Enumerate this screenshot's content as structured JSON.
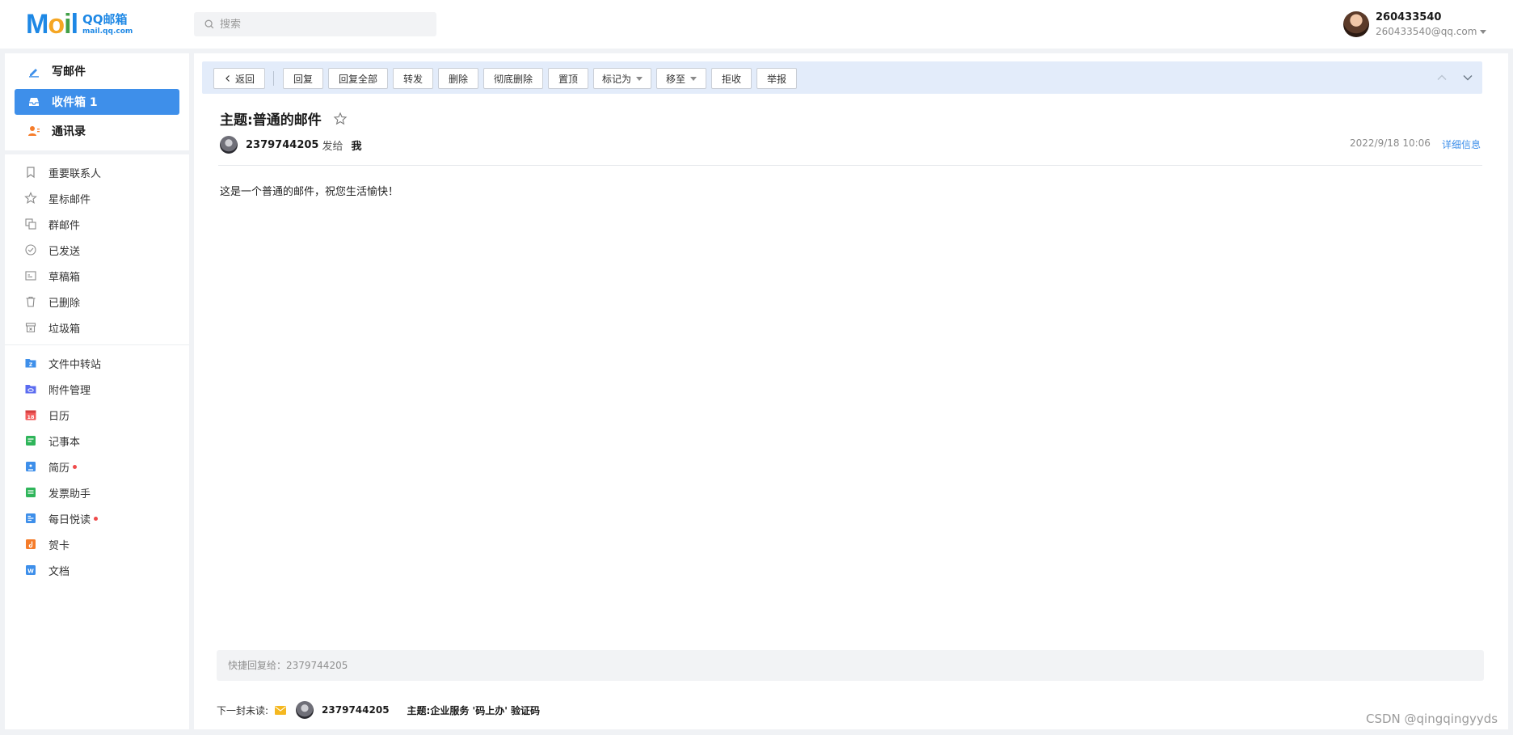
{
  "logo": {
    "word_m": "M",
    "word_o": "o",
    "word_i": "i",
    "word_l": "l",
    "line1": "QQ邮箱",
    "line2": "mail.qq.com"
  },
  "search": {
    "placeholder": "搜索"
  },
  "user": {
    "name": "260433540",
    "email": "260433540@qq.com"
  },
  "sidebar": {
    "main": [
      {
        "label": "写邮件",
        "icon": "pen-icon"
      },
      {
        "label": "收件箱 1",
        "icon": "inbox-icon",
        "active": true
      },
      {
        "label": "通讯录",
        "icon": "contacts-icon"
      }
    ],
    "folders": [
      {
        "label": "重要联系人",
        "icon": "bookmark-icon"
      },
      {
        "label": "星标邮件",
        "icon": "star-icon"
      },
      {
        "label": "群邮件",
        "icon": "group-mail-icon"
      },
      {
        "label": "已发送",
        "icon": "check-circle-icon"
      },
      {
        "label": "草稿箱",
        "icon": "draft-icon"
      },
      {
        "label": "已删除",
        "icon": "trash-icon"
      },
      {
        "label": "垃圾箱",
        "icon": "spam-icon"
      }
    ],
    "apps": [
      {
        "label": "文件中转站",
        "icon": "file-transfer-icon",
        "color": "#3e8fea"
      },
      {
        "label": "附件管理",
        "icon": "attachment-icon",
        "color": "#5b6cf0"
      },
      {
        "label": "日历",
        "icon": "calendar-icon",
        "color": "#f25a5a",
        "badge_text": "18"
      },
      {
        "label": "记事本",
        "icon": "notepad-icon",
        "color": "#2fb55a"
      },
      {
        "label": "简历",
        "icon": "resume-icon",
        "color": "#3e8fea",
        "dot": true
      },
      {
        "label": "发票助手",
        "icon": "invoice-icon",
        "color": "#2fb55a"
      },
      {
        "label": "每日悦读",
        "icon": "reading-icon",
        "color": "#3e8fea",
        "dot": true
      },
      {
        "label": "贺卡",
        "icon": "greeting-card-icon",
        "color": "#f57c2a"
      },
      {
        "label": "文档",
        "icon": "document-icon",
        "color": "#3e8fea",
        "badge_text": "W"
      }
    ]
  },
  "toolbar": {
    "back": "返回",
    "reply": "回复",
    "reply_all": "回复全部",
    "forward": "转发",
    "delete": "删除",
    "delete_permanently": "彻底删除",
    "pin": "置顶",
    "mark_as": "标记为",
    "move_to": "移至",
    "reject": "拒收",
    "report": "举报"
  },
  "mail": {
    "subject": "主题:普通的邮件",
    "sender": "2379744205",
    "sent_to_label": "发给",
    "recipient": "我",
    "date": "2022/9/18 10:06",
    "detail_link": "详细信息",
    "body": "这是一个普通的邮件，祝您生活愉快！"
  },
  "quick_reply": {
    "placeholder": "快捷回复给：2379744205"
  },
  "next_unread": {
    "label": "下一封未读:",
    "sender": "2379744205",
    "subject": "主题:企业服务 '码上办' 验证码"
  },
  "watermark": "CSDN @qingqingyyds"
}
